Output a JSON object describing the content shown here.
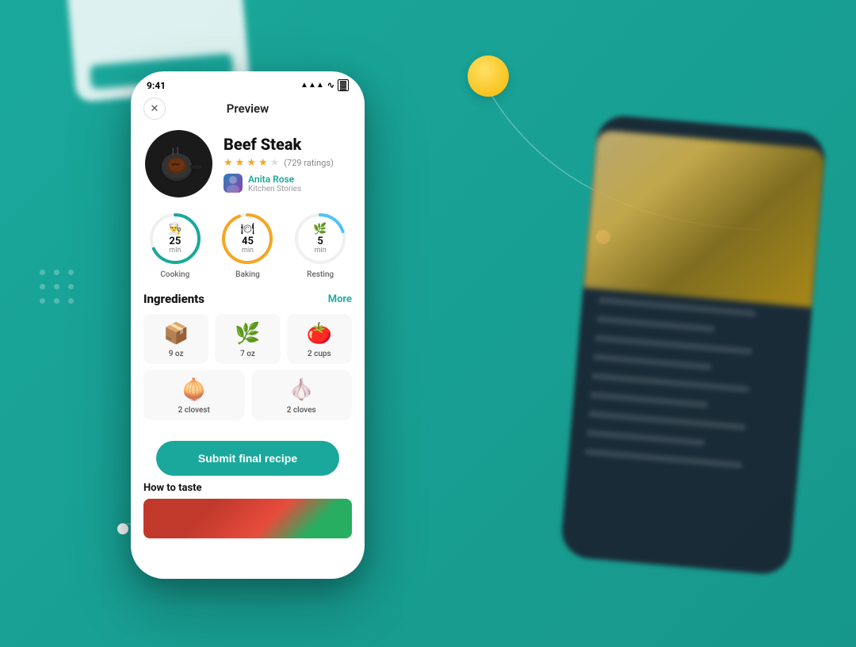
{
  "background": {
    "color": "#1aa89c"
  },
  "decorations": {
    "yellow_circle": "●",
    "white_dot_right": "●",
    "white_dot_left": "●"
  },
  "phone_main": {
    "status_bar": {
      "time": "9:41",
      "signal": "▲▲▲",
      "wifi": "wifi",
      "battery": "battery"
    },
    "header": {
      "close_label": "✕",
      "title": "Preview"
    },
    "recipe": {
      "title": "Beef Steak",
      "rating_value": "4.0",
      "rating_count": "(729 ratings)",
      "author_name": "Anita Rose",
      "author_source": "Kitchen Stories"
    },
    "times": [
      {
        "value": "25",
        "unit": "min",
        "label": "Cooking",
        "icon": "👨‍🍳",
        "color": "teal"
      },
      {
        "value": "45",
        "unit": "min",
        "label": "Baking",
        "icon": "🍽",
        "color": "orange"
      },
      {
        "value": "5",
        "unit": "min",
        "label": "Resting",
        "icon": "🌿",
        "color": "blue"
      }
    ],
    "ingredients": {
      "title": "Ingredients",
      "more_label": "More",
      "items": [
        {
          "emoji": "📦",
          "qty": "9 oz"
        },
        {
          "emoji": "🌿",
          "qty": "7 oz"
        },
        {
          "emoji": "🍅",
          "qty": "2 cups"
        },
        {
          "emoji": "🧅",
          "qty": "2 clovest"
        },
        {
          "emoji": "🧄",
          "qty": "2 cloves"
        }
      ]
    },
    "submit_button": "Submit final recipe",
    "how_to_taste": "How to taste"
  }
}
